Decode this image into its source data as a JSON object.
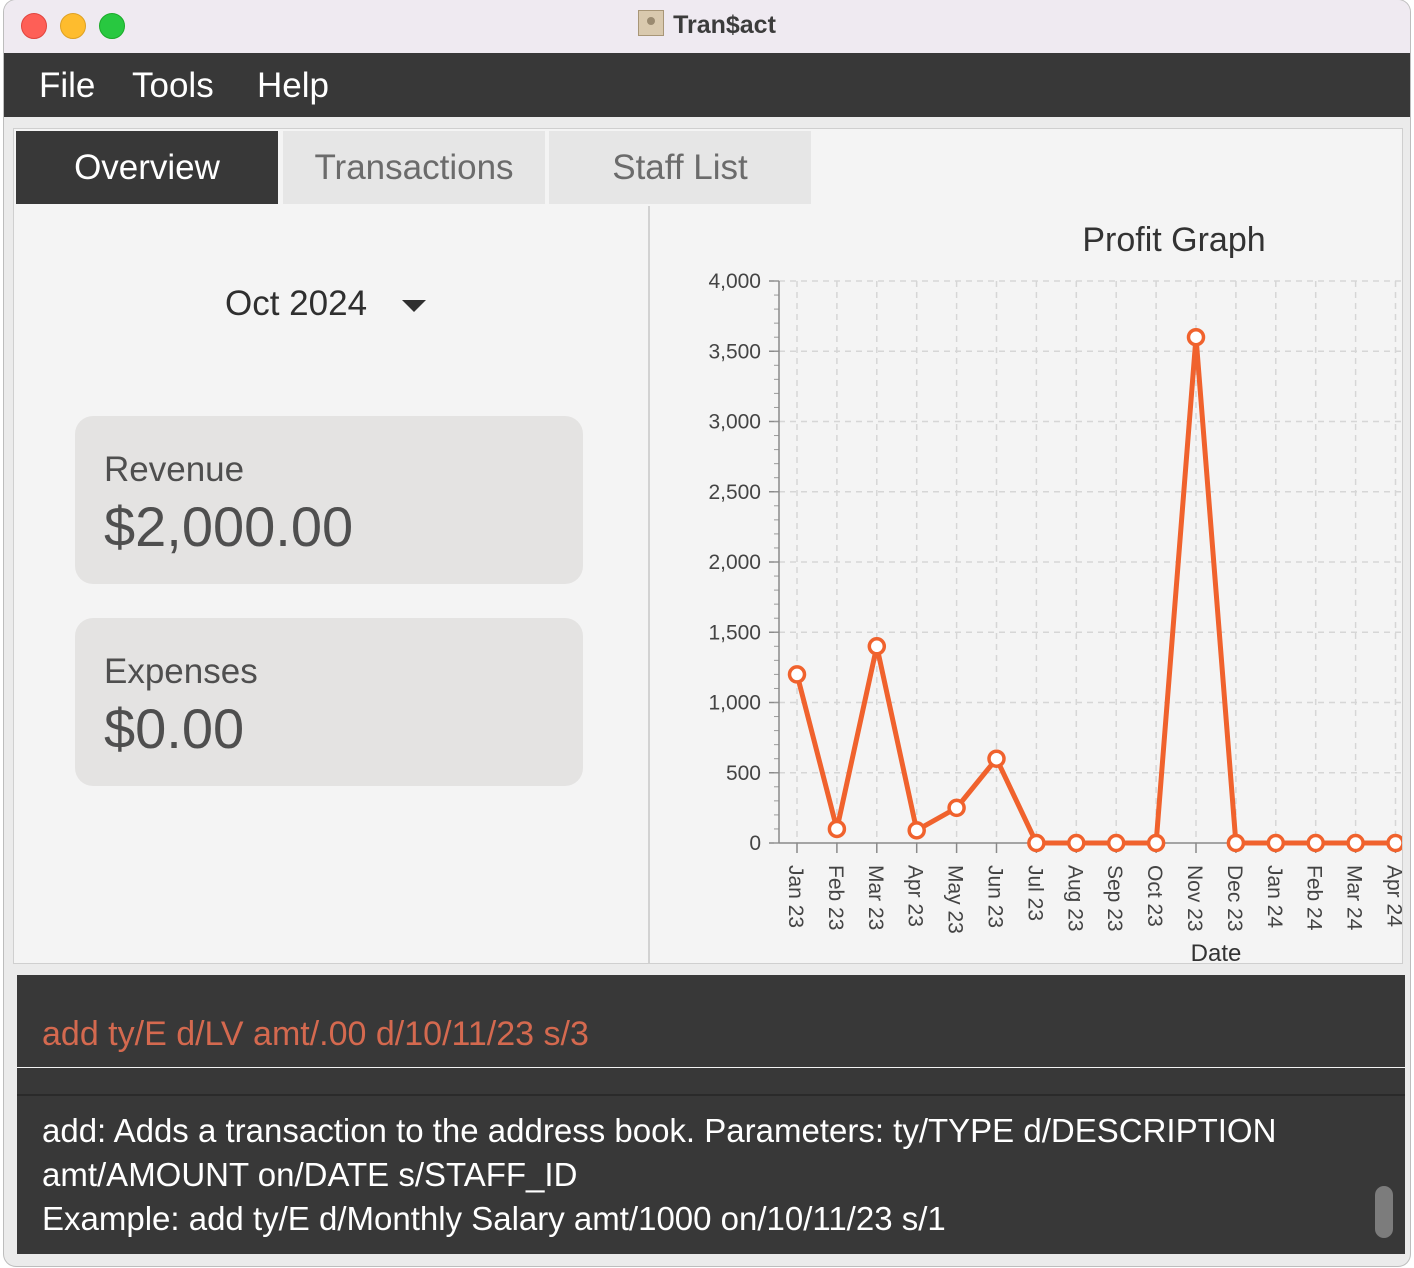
{
  "window": {
    "title": "Tran$act"
  },
  "menu": {
    "items": [
      "File",
      "Tools",
      "Help"
    ]
  },
  "tabs": [
    {
      "label": "Overview",
      "active": true
    },
    {
      "label": "Transactions",
      "active": false
    },
    {
      "label": "Staff List",
      "active": false
    }
  ],
  "overview": {
    "month": "Oct 2024",
    "revenue": {
      "label": "Revenue",
      "value": "$2,000.00"
    },
    "expenses": {
      "label": "Expenses",
      "value": "$0.00"
    }
  },
  "chart_data": {
    "type": "line",
    "title": "Profit Graph",
    "xlabel": "Date",
    "ylabel": "",
    "categories": [
      "Jan 23",
      "Feb 23",
      "Mar 23",
      "Apr 23",
      "May 23",
      "Jun 23",
      "Jul 23",
      "Aug 23",
      "Sep 23",
      "Oct 23",
      "Nov 23",
      "Dec 23",
      "Jan 24",
      "Feb 24",
      "Mar 24",
      "Apr 24"
    ],
    "values": [
      1200,
      100,
      1400,
      90,
      250,
      600,
      0,
      0,
      0,
      0,
      3600,
      0,
      0,
      0,
      0,
      0
    ],
    "ylim": [
      0,
      4000
    ],
    "yticks": [
      "0",
      "500",
      "1,000",
      "1,500",
      "2,000",
      "2,500",
      "3,000",
      "3,500",
      "4,000"
    ],
    "grid": true,
    "line_color": "#f0622d"
  },
  "command": {
    "text": "add ty/E d/LV amt/.00 d/10/11/23 s/3"
  },
  "result": {
    "lines": [
      "add: Adds a transaction to the address book. Parameters: ty/TYPE d/DESCRIPTION",
      "amt/AMOUNT on/DATE s/STAFF_ID",
      "Example: add ty/E d/Monthly Salary amt/1000 on/10/11/23 s/1"
    ]
  },
  "colors": {
    "dark": "#383838",
    "accent": "#f0622d",
    "command_text": "#d4694f"
  }
}
